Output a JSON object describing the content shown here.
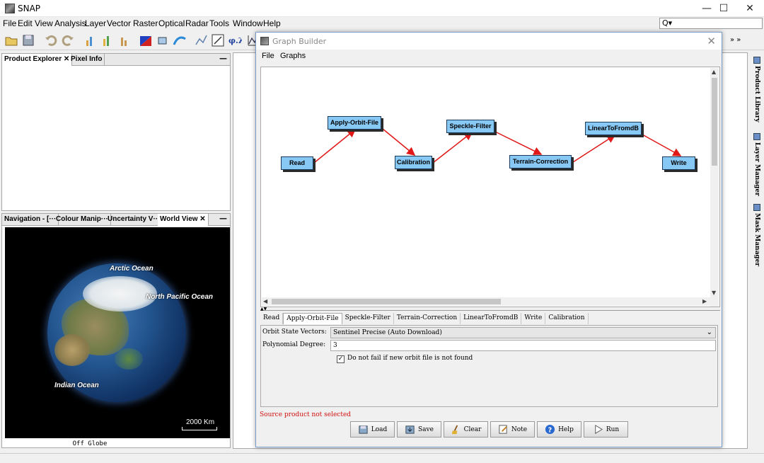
{
  "window": {
    "title": "SNAP",
    "minimize": "—",
    "maximize": "☐",
    "close": "✕"
  },
  "menu": [
    "File",
    "Edit",
    "View",
    "Analysis",
    "Layer",
    "Vector",
    "Raster",
    "Optical",
    "Radar",
    "Tools",
    "Window",
    "Help"
  ],
  "search": {
    "icon": "Q▾"
  },
  "left_top_panel": {
    "tabs": [
      "Product Explorer ✕",
      "Pixel Info"
    ],
    "minimize": "—"
  },
  "left_bottom_panel": {
    "tabs": [
      "Navigation - [···",
      "Colour Manip···",
      "Uncertainty V···",
      "World View ✕"
    ],
    "minimize": "—",
    "labels": {
      "arctic": "Arctic Ocean",
      "pacific": "North Pacific Ocean",
      "indian": "Indian Ocean"
    },
    "scale": "2000 Km",
    "status": "Off Globe"
  },
  "right_sidebar": [
    "Product Library",
    "Layer Manager",
    "Mask Manager"
  ],
  "dialog": {
    "title": "Graph Builder",
    "close": "✕",
    "menu": [
      "File",
      "Graphs"
    ],
    "nodes": {
      "read": "Read",
      "orbit": "Apply-Orbit-File",
      "calibration": "Calibration",
      "speckle": "Speckle-Filter",
      "terrain": "Terrain-Correction",
      "linear": "LinearToFromdB",
      "write": "Write"
    },
    "collapse": "▲▼",
    "tabs": [
      "Read",
      "Apply-Orbit-File",
      "Speckle-Filter",
      "Terrain-Correction",
      "LinearToFromdB",
      "Write",
      "Calibration"
    ],
    "active_tab": "Apply-Orbit-File",
    "props": {
      "orbit_label": "Orbit State Vectors:",
      "orbit_value": "Sentinel Precise (Auto Download)",
      "poly_label": "Polynomial Degree:",
      "poly_value": "3",
      "fail_label": "Do not fail if new orbit file is not found",
      "fail_checked": "✓"
    },
    "status": "Source product not selected",
    "buttons": [
      "Load",
      "Save",
      "Clear",
      "Note",
      "Help",
      "Run"
    ]
  },
  "colors": {
    "node": "#87c8f4",
    "arrow": "#e01818",
    "error": "#d01010"
  }
}
